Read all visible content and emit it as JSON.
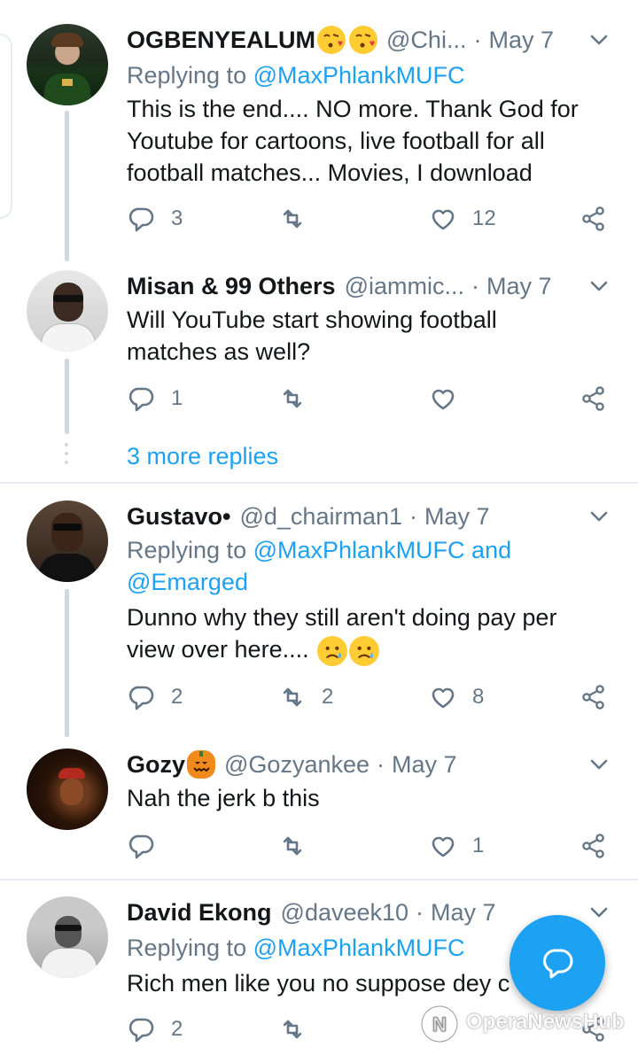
{
  "tweets": [
    {
      "name": "OGBENYEALUM",
      "handle": "@Chi...",
      "date": "May 7",
      "reply_prefix": "Replying to ",
      "reply_mention": "@MaxPhlankMUFC",
      "text": "This is the end.... NO more. Thank God for Youtube for cartoons, live football for all football matches... Movies, I download",
      "replies": "3",
      "retweets": "",
      "likes": "12"
    },
    {
      "name": "Misan & 99 Others",
      "handle": "@iammic...",
      "date": "May 7",
      "text": "Will YouTube start showing football matches as well?",
      "replies": "1",
      "retweets": "",
      "likes": ""
    },
    {
      "name": "Gustavo",
      "name_suffix": " •",
      "handle": "@d_chairman1",
      "date": "May 7",
      "reply_prefix": "Replying to ",
      "reply_mention": "@MaxPhlankMUFC",
      "reply_and": " and",
      "reply_mention2": "@Emarged",
      "text": "Dunno why they still aren't doing pay per view over here....",
      "replies": "2",
      "retweets": "2",
      "likes": "8"
    },
    {
      "name": "Gozy",
      "handle": "@Gozyankee",
      "date": "May 7",
      "text": "Nah the jerk b this",
      "replies": "",
      "retweets": "",
      "likes": "1"
    },
    {
      "name": "David Ekong",
      "handle": "@daveek10",
      "date": "May 7",
      "reply_prefix": "Replying to ",
      "reply_mention": "@MaxPhlankMUFC",
      "text": "Rich men like you no suppose dey c",
      "replies": "2",
      "retweets": "",
      "likes": ""
    }
  ],
  "more_replies": "3 more replies",
  "watermark": "OperaNewsHub",
  "colors": {
    "accent": "#1da1f2",
    "muted": "#657786",
    "text": "#14171a",
    "line": "#cfd9de"
  },
  "icons": [
    "reply-icon",
    "retweet-icon",
    "like-icon",
    "share-icon",
    "chevron-down-icon",
    "compose-reply-icon"
  ]
}
